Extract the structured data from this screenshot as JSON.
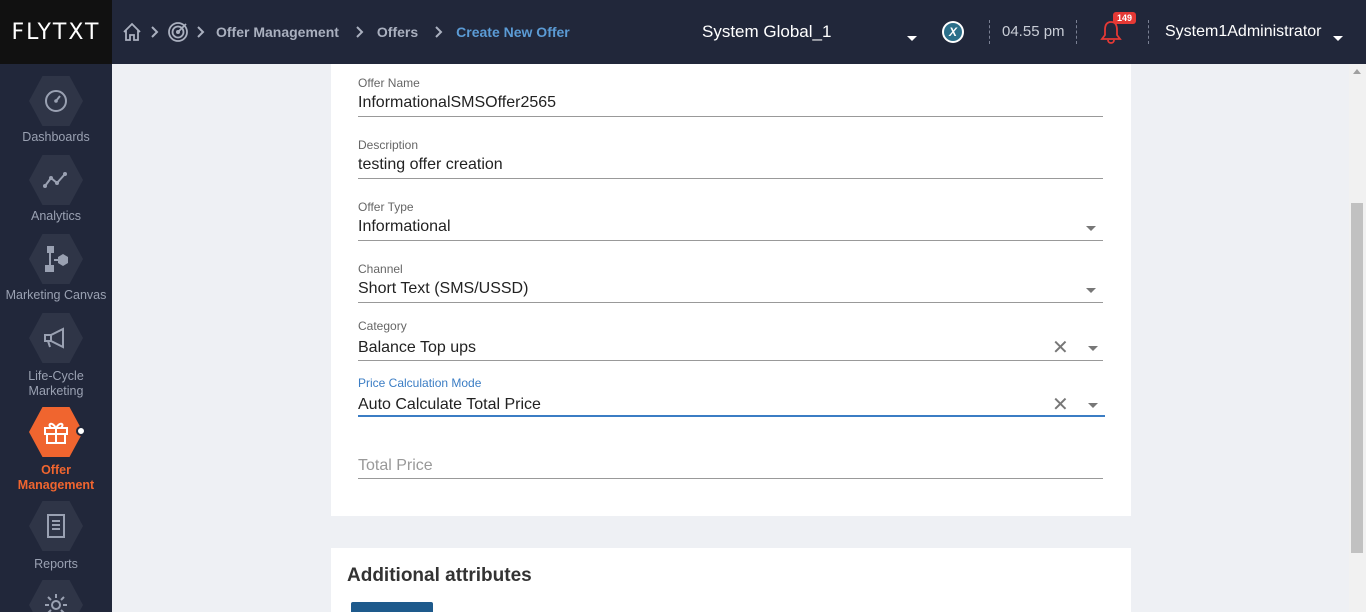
{
  "header": {
    "logo": "FLYTXT",
    "breadcrumbs": [
      "Offer Management",
      "Offers",
      "Create New Offer"
    ],
    "organization": "System Global_1",
    "time": "04.55 pm",
    "notification_count": "149",
    "user": "System1Administrator"
  },
  "sidebar": {
    "items": [
      {
        "label": "Dashboards",
        "icon": "gauge-icon"
      },
      {
        "label": "Analytics",
        "icon": "line-chart-icon"
      },
      {
        "label": "Marketing Canvas",
        "icon": "flow-icon"
      },
      {
        "label": "Life-Cycle Marketing",
        "icon": "megaphone-icon"
      },
      {
        "label": "Offer Management",
        "icon": "gift-icon",
        "active": true
      },
      {
        "label": "Reports",
        "icon": "document-icon"
      },
      {
        "label": "",
        "icon": "gear-icon"
      }
    ]
  },
  "form": {
    "offer_name": {
      "label": "Offer Name",
      "value": "InformationalSMSOffer2565"
    },
    "description": {
      "label": "Description",
      "value": "testing offer creation"
    },
    "offer_type": {
      "label": "Offer Type",
      "value": "Informational"
    },
    "channel": {
      "label": "Channel",
      "value": "Short Text (SMS/USSD)"
    },
    "category": {
      "label": "Category",
      "value": "Balance Top ups"
    },
    "price_mode": {
      "label": "Price Calculation Mode",
      "value": "Auto Calculate Total Price"
    },
    "total_price": {
      "placeholder": "Total Price"
    }
  },
  "additional": {
    "title": "Additional attributes"
  },
  "colors": {
    "accent": "#f0652f",
    "focus": "#3b7dc4",
    "topbar": "#21273a"
  }
}
